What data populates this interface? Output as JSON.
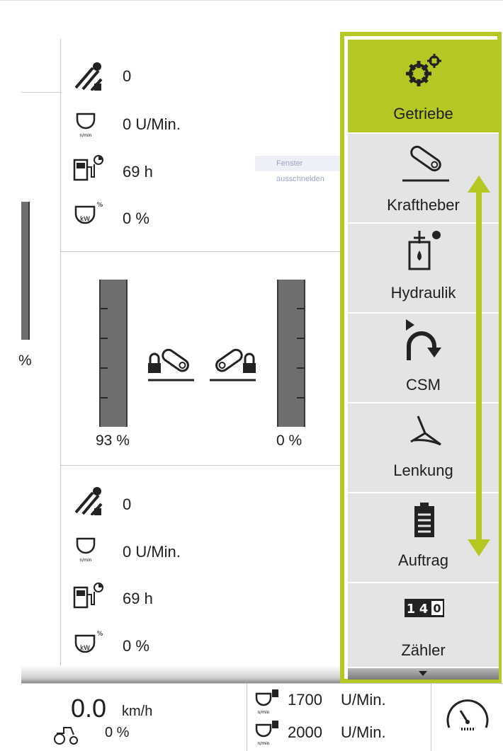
{
  "top_panel": {
    "area_value": "0",
    "rpm_value": "0 U/Min.",
    "hours_value": "69 h",
    "power_value": "0 %"
  },
  "middle_panel": {
    "left_partial_value": "%",
    "left_gauge_value": "93 %",
    "right_gauge_value": "0 %",
    "left_gauge_level": 0.93,
    "right_gauge_level": 0.0
  },
  "bottom_panel": {
    "area_value": "0",
    "rpm_value": "0 U/Min.",
    "hours_value": "69 h",
    "power_value": "0 %"
  },
  "tooltip": {
    "text": "Fenster ausschneiden"
  },
  "menu": {
    "items": [
      {
        "label": "Getriebe",
        "icon": "gears-icon",
        "active": true
      },
      {
        "label": "Kraftheber",
        "icon": "hitch-lever-icon",
        "active": false
      },
      {
        "label": "Hydraulik",
        "icon": "hydraulic-tank-icon",
        "active": false
      },
      {
        "label": "CSM",
        "icon": "turn-arrow-icon",
        "active": false
      },
      {
        "label": "Lenkung",
        "icon": "steering-icon",
        "active": false
      },
      {
        "label": "Auftrag",
        "icon": "clipboard-icon",
        "active": false
      },
      {
        "label": "Zähler",
        "icon": "counter-icon",
        "active": false
      }
    ],
    "accent_color": "#b5c723"
  },
  "footer": {
    "speed_value": "0.0",
    "speed_unit": "km/h",
    "slip_value": "0 %",
    "rpm1_value": "1700",
    "rpm1_unit": "U/Min.",
    "rpm2_value": "2000",
    "rpm2_unit": "U/Min."
  }
}
